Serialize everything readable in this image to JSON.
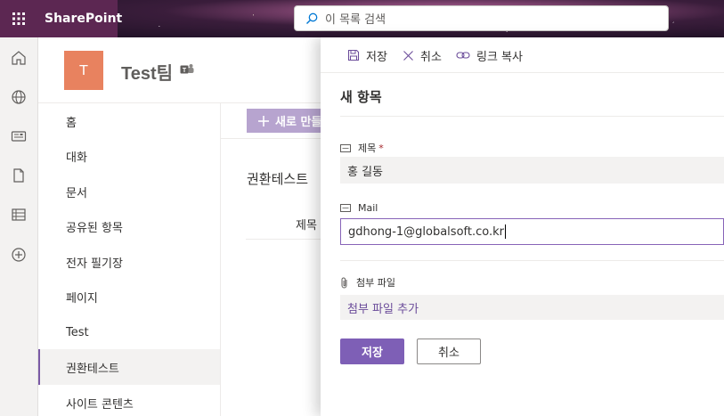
{
  "suite": {
    "app_name": "SharePoint",
    "search_placeholder": "이 목록 검색"
  },
  "site": {
    "logo_letter": "T",
    "title": "Test팀"
  },
  "nav": {
    "items": [
      {
        "label": "홈"
      },
      {
        "label": "대화"
      },
      {
        "label": "문서"
      },
      {
        "label": "공유된 항목"
      },
      {
        "label": "전자 필기장"
      },
      {
        "label": "페이지"
      },
      {
        "label": "Test"
      },
      {
        "label": "권환테스트",
        "selected": true
      },
      {
        "label": "사이트 콘텐츠"
      }
    ]
  },
  "list": {
    "new_button": "새로 만들",
    "title": "권환테스트",
    "column_title": "제목"
  },
  "panel": {
    "toolbar": {
      "save": "저장",
      "cancel": "취소",
      "copy_link": "링크 복사"
    },
    "title": "새 항목",
    "fields": {
      "title_label": "제목",
      "title_required": "*",
      "title_value": "홍 길동",
      "mail_label": "Mail",
      "mail_value": "gdhong-1@globalsoft.co.kr",
      "attach_label": "첨부 파일",
      "attach_link": "첨부 파일 추가"
    },
    "buttons": {
      "save": "저장",
      "cancel": "취소"
    }
  },
  "colors": {
    "accent": "#7e5fb6",
    "suite_bg": "#5c2752",
    "site_logo": "#e8825f"
  },
  "icons": [
    "waffle-icon",
    "search-icon",
    "home-icon",
    "globe-icon",
    "news-icon",
    "file-icon",
    "list-icon",
    "add-icon",
    "teams-icon",
    "save-icon",
    "close-icon",
    "link-icon",
    "text-field-icon",
    "paperclip-icon",
    "add-plus-icon"
  ]
}
